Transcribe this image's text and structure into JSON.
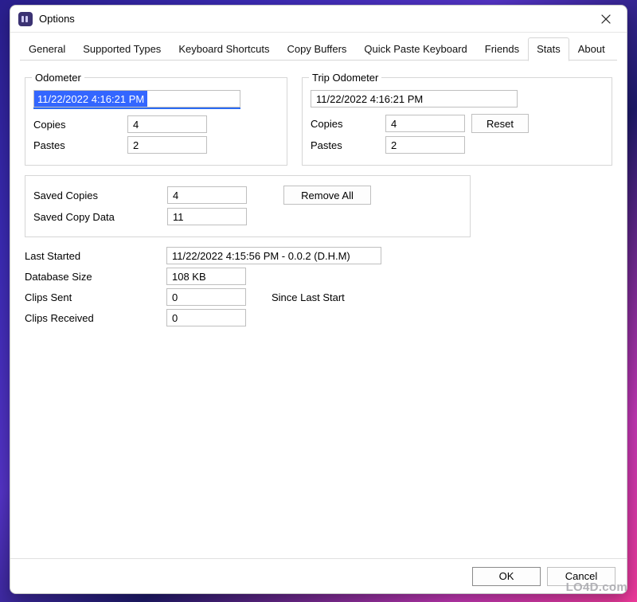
{
  "window": {
    "title": "Options"
  },
  "tabs": {
    "general": "General",
    "supported_types": "Supported Types",
    "keyboard_shortcuts": "Keyboard Shortcuts",
    "copy_buffers": "Copy Buffers",
    "quick_paste_keyboard": "Quick Paste Keyboard",
    "friends": "Friends",
    "stats": "Stats",
    "about": "About",
    "active": "stats"
  },
  "odometer": {
    "legend": "Odometer",
    "date": "11/22/2022 4:16:21 PM",
    "copies_label": "Copies",
    "copies_value": "4",
    "pastes_label": "Pastes",
    "pastes_value": "2"
  },
  "trip_odometer": {
    "legend": "Trip Odometer",
    "date": "11/22/2022 4:16:21 PM",
    "copies_label": "Copies",
    "copies_value": "4",
    "pastes_label": "Pastes",
    "pastes_value": "2",
    "reset_label": "Reset"
  },
  "saved": {
    "copies_label": "Saved Copies",
    "copies_value": "4",
    "copy_data_label": "Saved Copy Data",
    "copy_data_value": "11",
    "remove_all_label": "Remove All"
  },
  "stats": {
    "last_started_label": "Last Started",
    "last_started_value": "11/22/2022 4:15:56 PM  -  0.0.2 (D.H.M)",
    "database_size_label": "Database Size",
    "database_size_value": "108 KB",
    "clips_sent_label": "Clips Sent",
    "clips_sent_value": "0",
    "clips_received_label": "Clips Received",
    "clips_received_value": "0",
    "since_last_start": "Since Last Start"
  },
  "footer": {
    "ok": "OK",
    "cancel": "Cancel"
  },
  "watermark": "LO4D.com"
}
